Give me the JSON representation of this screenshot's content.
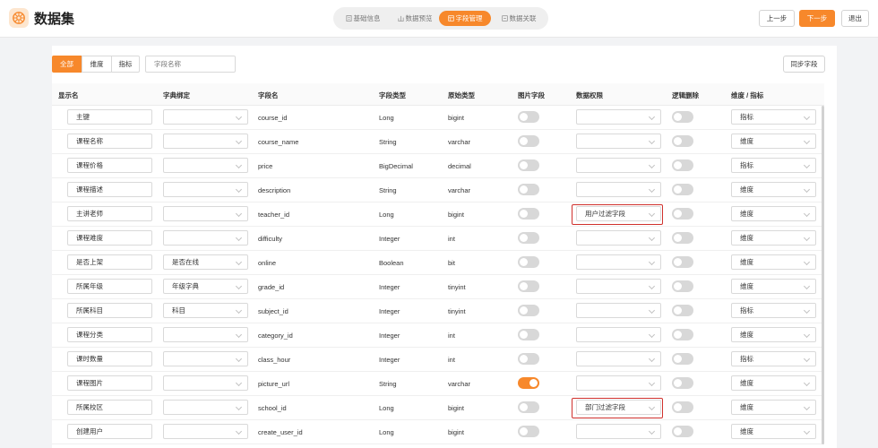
{
  "app": {
    "title": "数据集"
  },
  "steps": [
    {
      "label": "基础信息",
      "icon": "document-icon"
    },
    {
      "label": "数据预览",
      "icon": "chart-icon"
    },
    {
      "label": "字段管理",
      "icon": "field-icon"
    },
    {
      "label": "数据关联",
      "icon": "link-icon"
    }
  ],
  "active_step": 2,
  "actions": {
    "prev": "上一步",
    "next": "下一步",
    "exit": "退出"
  },
  "filter": {
    "tabs": [
      "全部",
      "维度",
      "指标"
    ],
    "active": 0,
    "placeholder": "字段名称"
  },
  "sync_label": "同步字段",
  "columns": [
    "显示名",
    "字典绑定",
    "字段名",
    "字段类型",
    "原始类型",
    "图片字段",
    "数据权限",
    "逻辑删除",
    "维度 / 指标"
  ],
  "rows": [
    {
      "display": "主键",
      "dict": "",
      "field": "course_id",
      "type": "Long",
      "raw": "bigint",
      "image": false,
      "perm": "",
      "del": false,
      "dim": "指标"
    },
    {
      "display": "课程名称",
      "dict": "",
      "field": "course_name",
      "type": "String",
      "raw": "varchar",
      "image": false,
      "perm": "",
      "del": false,
      "dim": "维度"
    },
    {
      "display": "课程价格",
      "dict": "",
      "field": "price",
      "type": "BigDecimal",
      "raw": "decimal",
      "image": false,
      "perm": "",
      "del": false,
      "dim": "指标"
    },
    {
      "display": "课程描述",
      "dict": "",
      "field": "description",
      "type": "String",
      "raw": "varchar",
      "image": false,
      "perm": "",
      "del": false,
      "dim": "维度"
    },
    {
      "display": "主讲老师",
      "dict": "",
      "field": "teacher_id",
      "type": "Long",
      "raw": "bigint",
      "image": false,
      "perm": "用户过滤字段",
      "del": false,
      "dim": "维度"
    },
    {
      "display": "课程难度",
      "dict": "",
      "field": "difficulty",
      "type": "Integer",
      "raw": "int",
      "image": false,
      "perm": "",
      "del": false,
      "dim": "维度"
    },
    {
      "display": "是否上架",
      "dict": "是否在线",
      "field": "online",
      "type": "Boolean",
      "raw": "bit",
      "image": false,
      "perm": "",
      "del": false,
      "dim": "维度"
    },
    {
      "display": "所属年级",
      "dict": "年级字典",
      "field": "grade_id",
      "type": "Integer",
      "raw": "tinyint",
      "image": false,
      "perm": "",
      "del": false,
      "dim": "维度"
    },
    {
      "display": "所属科目",
      "dict": "科目",
      "field": "subject_id",
      "type": "Integer",
      "raw": "tinyint",
      "image": false,
      "perm": "",
      "del": false,
      "dim": "指标"
    },
    {
      "display": "课程分类",
      "dict": "",
      "field": "category_id",
      "type": "Integer",
      "raw": "int",
      "image": false,
      "perm": "",
      "del": false,
      "dim": "维度"
    },
    {
      "display": "课时数量",
      "dict": "",
      "field": "class_hour",
      "type": "Integer",
      "raw": "int",
      "image": false,
      "perm": "",
      "del": false,
      "dim": "指标"
    },
    {
      "display": "课程图片",
      "dict": "",
      "field": "picture_url",
      "type": "String",
      "raw": "varchar",
      "image": true,
      "perm": "",
      "del": false,
      "dim": "维度"
    },
    {
      "display": "所属校区",
      "dict": "",
      "field": "school_id",
      "type": "Long",
      "raw": "bigint",
      "image": false,
      "perm": "部门过滤字段",
      "del": false,
      "dim": "维度"
    },
    {
      "display": "创建用户",
      "dict": "",
      "field": "create_user_id",
      "type": "Long",
      "raw": "bigint",
      "image": false,
      "perm": "",
      "del": false,
      "dim": "维度"
    }
  ],
  "highlighted_rows": [
    4,
    12
  ],
  "colors": {
    "accent": "#f7882b",
    "highlight": "#d0312d"
  }
}
